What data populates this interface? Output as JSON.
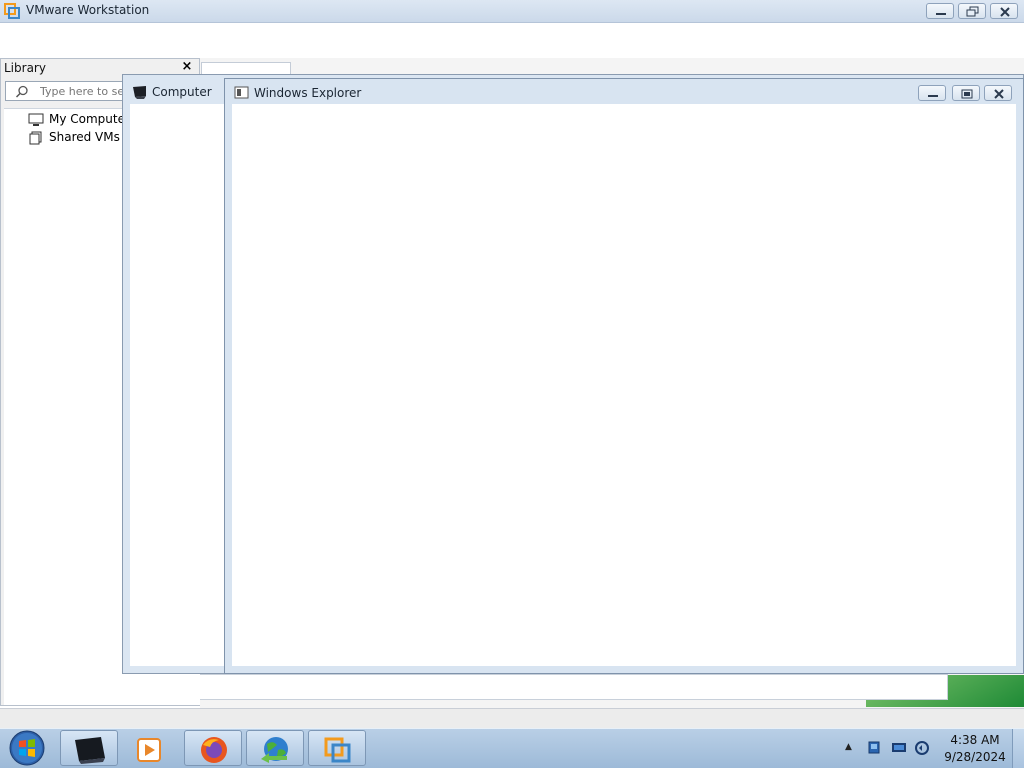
{
  "vmware": {
    "title": "VMware Workstation",
    "library": {
      "title": "Library",
      "close_glyph": "×",
      "search_placeholder": "Type here to search",
      "tree": [
        {
          "label": "My Computer",
          "icon": "monitor-icon"
        },
        {
          "label": "Shared VMs",
          "icon": "shared-vms-icon"
        }
      ]
    }
  },
  "computer_window": {
    "title": "Computer"
  },
  "explorer_window": {
    "title": "Windows Explorer"
  },
  "taskbar": {
    "apps": [
      "command-prompt",
      "media-player",
      "firefox",
      "network-globe",
      "vmware-workstation"
    ],
    "tray_arrow": "▲",
    "clock": {
      "time": "4:38 AM",
      "date": "9/28/2024"
    }
  },
  "colors": {
    "titlebar": "#cbd9ea",
    "taskbar": "#a9c3df",
    "window_frame": "#d8e4f1",
    "accent_green": "#3aa14a"
  }
}
